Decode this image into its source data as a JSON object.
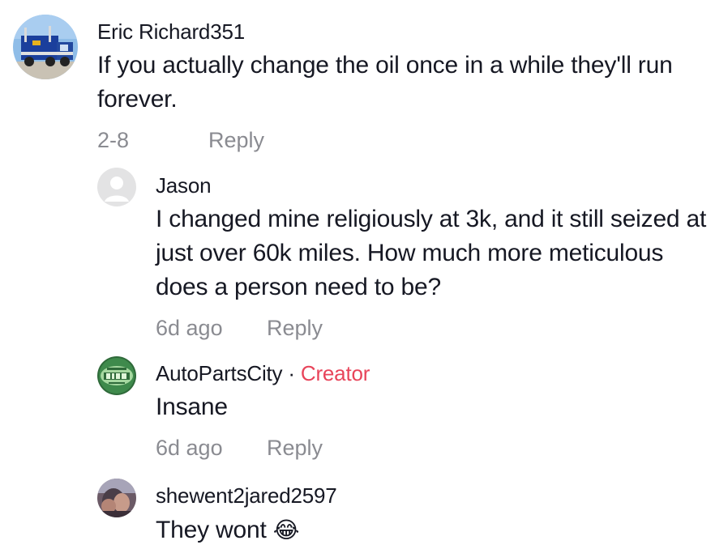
{
  "comments": [
    {
      "username": "Eric Richard351",
      "text": "If you actually change the oil once in a while they'll run forever.",
      "date": "2-8",
      "reply_label": "Reply"
    },
    {
      "username": "Jason",
      "text": "I changed mine religiously at 3k, and it still seized at just over 60k miles. How much more meticulous does a person need to be?",
      "date": "6d ago",
      "reply_label": "Reply"
    },
    {
      "username": "AutoPartsCity",
      "separator": "·",
      "badge": "Creator",
      "text": "Insane",
      "date": "6d ago",
      "reply_label": "Reply",
      "avatar_label": "AUTO PARTS CITY"
    },
    {
      "username": "shewent2jared2597",
      "text": "They wont",
      "emoji": "😂"
    }
  ],
  "colors": {
    "text": "#161823",
    "muted": "#8a8b91",
    "creator": "#e8445a"
  }
}
